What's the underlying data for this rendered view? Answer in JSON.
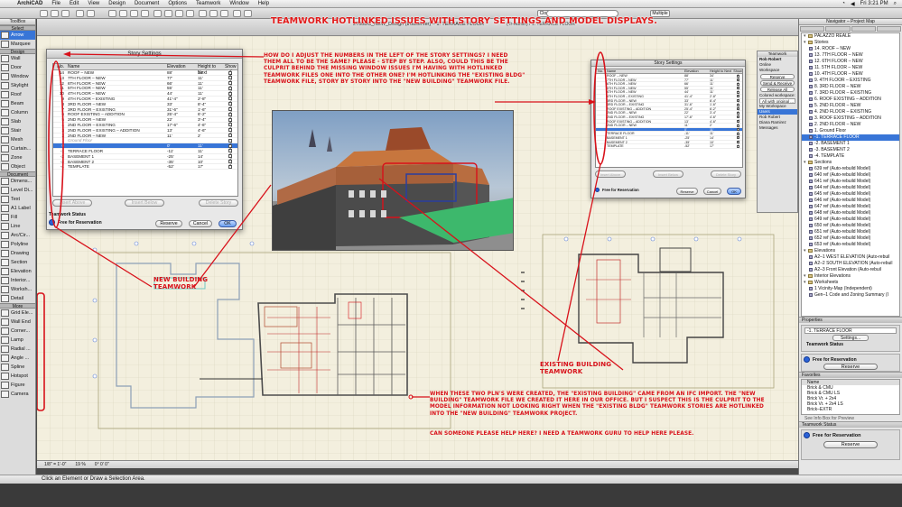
{
  "menubar": {
    "app": "ArchiCAD",
    "items": [
      "File",
      "Edit",
      "View",
      "Design",
      "Document",
      "Options",
      "Teamwork",
      "Window",
      "Help"
    ],
    "clock": "Fri 3:21 PM"
  },
  "toolbar": {
    "close_label": "Close",
    "search_placeholder": "",
    "zoom_label": "Multiple"
  },
  "toolbox": {
    "title": "ToolBox",
    "select_group": "Select",
    "tools_select": [
      {
        "label": "Arrow",
        "selected": true
      },
      {
        "label": "Marquee",
        "selected": false
      }
    ],
    "design_group": "Design",
    "tools_design": [
      "Wall",
      "Door",
      "Window",
      "Skylight",
      "Roof",
      "Beam",
      "Column",
      "Slab",
      "Stair",
      "Mesh",
      "Curtain...",
      "Zone",
      "Object"
    ],
    "document_group": "Document",
    "tools_document": [
      "Dimens...",
      "Level Di...",
      "Text",
      "A1 Label",
      "Fill",
      "Line",
      "Arc/Cir...",
      "Polyline",
      "Drawing",
      "Section",
      "Elevation",
      "Interior...",
      "Worksh...",
      "Detail"
    ],
    "more_group": "More",
    "tools_more": [
      "Grid Ele...",
      "Wall End",
      "Corner...",
      "Lamp",
      "Radial ...",
      "Angle ...",
      "Spline",
      "Hotspot",
      "Figure",
      "Camera"
    ]
  },
  "document": {
    "window_title": "2700DC_NEW_Design (trouserver) – 1. TERRACE FLOOR",
    "window_title_right": "(Tr-Admin) / 1. TERRACE FLOOR",
    "status_items": [
      "1/8\" = 1'-0\"",
      "19 %",
      "0° 0' 0\""
    ]
  },
  "headline": "Teamwork hotlinked issues with story settings and model displays.",
  "question": "How do I adjust the numbers in the left of the story settings? I need them all to be the same? Please - step by step. Also, could this be the culprit behind the missing window issues I'm having with hotlinked teamwork files one into the other one? I'm hotlinking the \"existing bldg\" teamwork file, story by story into the \"new building\" teamwork file.",
  "annotations": {
    "new_building": "New Building\nTeamwork",
    "existing_building": "Existing Building\nTeamwork",
    "created": "When these two PLN's were created, the \"existing building\" came from an IFC import. The \"new building\" teamwork file we created it here in our office. But I suspect this is the culprit to the model information not looking right when the \"existing bldg\" teamwork stories are hotlinked into the \"new building\" teamwork project.",
    "help": "Can someone please help here? I need a teamwork guru to help here please."
  },
  "story_dialog": {
    "title": "Story Settings",
    "columns": [
      "No.",
      "Name",
      "Elevation",
      "Height to Next",
      "Show"
    ],
    "rows": [
      {
        "no": "14",
        "name": "ROOF – NEW",
        "elev": "88'",
        "height": "34'",
        "show": true
      },
      {
        "no": "13",
        "name": "7TH FLOOR – NEW",
        "elev": "77'",
        "height": "11'",
        "show": true
      },
      {
        "no": "12",
        "name": "6TH FLOOR – NEW",
        "elev": "66'",
        "height": "11'",
        "show": true
      },
      {
        "no": "11",
        "name": "5TH FLOOR – NEW",
        "elev": "55'",
        "height": "11'",
        "show": true
      },
      {
        "no": "10",
        "name": "4TH FLOOR – NEW",
        "elev": "44'",
        "height": "11'",
        "show": true
      },
      {
        "no": "9",
        "name": "4TH FLOOR – EXISTING",
        "elev": "41'-4\"",
        "height": "2'-8\"",
        "show": true
      },
      {
        "no": "8",
        "name": "3RD FLOOR – NEW",
        "elev": "33'",
        "height": "8'-4\"",
        "show": true
      },
      {
        "no": "7",
        "name": "3RD FLOOR – EXISTING",
        "elev": "31'-6\"",
        "height": "1'-6\"",
        "show": true
      },
      {
        "no": "6",
        "name": "ROOF EXISTING – ADDITION",
        "elev": "25'-4\"",
        "height": "6'-2\"",
        "show": true
      },
      {
        "no": "5",
        "name": "2ND FLOOR – NEW",
        "elev": "22'",
        "height": "3'-4\"",
        "show": true
      },
      {
        "no": "4",
        "name": "2ND FLOOR – EXISTING",
        "elev": "17'-6\"",
        "height": "4'-6\"",
        "show": true
      },
      {
        "no": "3",
        "name": "2ND FLOOR – EXISTING – ADDITION",
        "elev": "13'",
        "height": "4'-6\"",
        "show": true
      },
      {
        "no": "2",
        "name": "2ND FLOOR – NEW",
        "elev": "11'",
        "height": "2'",
        "show": true
      },
      {
        "no": "1",
        "name": "Ground Floor",
        "elev": "",
        "height": "",
        "show": false,
        "ghost": true
      },
      {
        "no": "0",
        "name": "",
        "elev": "0'",
        "height": "11'",
        "show": true,
        "selected": true
      },
      {
        "no": "-1",
        "name": "TERRACE FLOOR",
        "elev": "-11'",
        "height": "11'",
        "show": true
      },
      {
        "no": "-2",
        "name": "BASEMENT 1",
        "elev": "-25'",
        "height": "14'",
        "show": true
      },
      {
        "no": "-3",
        "name": "BASEMENT 2",
        "elev": "-35'",
        "height": "10'",
        "show": true
      },
      {
        "no": "-4",
        "name": "TEMPLATE",
        "elev": "-52'",
        "height": "17'",
        "show": true
      }
    ],
    "insert_above": "Insert Above",
    "insert_below": "Insert Below",
    "delete_story": "Delete Story",
    "teamwork_status_label": "Teamwork Status",
    "free_label": "Free for Reservation",
    "reserve": "Reserve",
    "cancel": "Cancel",
    "ok": "OK"
  },
  "story_dialog2": {
    "title": "Story Settings",
    "rows": [
      {
        "no": "",
        "name": "ROOF – NEW",
        "elev": "88'",
        "height": "34'"
      },
      {
        "no": "",
        "name": "7TH FLOOR – NEW",
        "elev": "77'",
        "height": "11'"
      },
      {
        "no": "",
        "name": "6TH FLOOR – NEW",
        "elev": "66'",
        "height": "11'"
      },
      {
        "no": "",
        "name": "5TH FLOOR – NEW",
        "elev": "55'",
        "height": "11'"
      },
      {
        "no": "",
        "name": "4TH FLOOR – NEW",
        "elev": "44'",
        "height": "11'"
      },
      {
        "no": "",
        "name": "4TH FLOOR – EXISTING",
        "elev": "41'-4\"",
        "height": "2'-8\""
      },
      {
        "no": "",
        "name": "3RD FLOOR – NEW",
        "elev": "33'",
        "height": "8'-4\""
      },
      {
        "no": "",
        "name": "3RD FLOOR – EXISTING",
        "elev": "31'-6\"",
        "height": "1'-6\""
      },
      {
        "no": "",
        "name": "ROOF EXISTING – ADDITION",
        "elev": "25'-4\"",
        "height": "6'-2\""
      },
      {
        "no": "",
        "name": "2ND FLOOR – NEW",
        "elev": "22'",
        "height": "3'-4\""
      },
      {
        "no": "",
        "name": "2ND FLOOR – EXISTING",
        "elev": "17'-6\"",
        "height": "4'-6\""
      },
      {
        "no": "",
        "name": "ROOF EXISTING – ADDITION",
        "elev": "13'",
        "height": "4'-6\""
      },
      {
        "no": "",
        "name": "2ND FLOOR – NEW",
        "elev": "11'",
        "height": "2'"
      },
      {
        "no": "",
        "name": "",
        "elev": "0'",
        "height": "11'",
        "selected": true
      },
      {
        "no": "",
        "name": "TERRACE FLOOR",
        "elev": "-11'",
        "height": "11'"
      },
      {
        "no": "",
        "name": "BASEMENT 1",
        "elev": "-25'",
        "height": "14'"
      },
      {
        "no": "",
        "name": "BASEMENT 2",
        "elev": "-35'",
        "height": "10'"
      },
      {
        "no": "",
        "name": "TEMPLATE",
        "elev": "-52'",
        "height": "17'"
      }
    ],
    "insert_above": "Insert Above",
    "insert_below": "Insert Below",
    "delete_story": "Delete Story",
    "free_label": "Free for Reservation",
    "reserve": "Reserve",
    "cancel": "Cancel",
    "ok": "OK"
  },
  "tw_panel": {
    "title": "Teamwork",
    "user": "Rob Robert",
    "rows": [
      "Online",
      "Workspace",
      "Reserve",
      "Release All",
      "Colored workspace:",
      "All with original ...",
      "My Workspace",
      "Users",
      "Rob Robert",
      "Diana Ramirez",
      "Messages"
    ],
    "send_receive": "Send & Receive"
  },
  "navigator": {
    "title": "Navigator – Project Map",
    "tree": [
      {
        "label": "PALAZZO REALE",
        "depth": 0,
        "kind": "root"
      },
      {
        "label": "Stories",
        "depth": 0,
        "kind": "folder"
      },
      {
        "label": "14. ROOF – NEW",
        "depth": 1,
        "kind": "item"
      },
      {
        "label": "13. 7TH FLOOR – NEW",
        "depth": 1,
        "kind": "item"
      },
      {
        "label": "12. 6TH FLOOR – NEW",
        "depth": 1,
        "kind": "item"
      },
      {
        "label": "11. 5TH FLOOR – NEW",
        "depth": 1,
        "kind": "item"
      },
      {
        "label": "10. 4TH FLOOR – NEW",
        "depth": 1,
        "kind": "item"
      },
      {
        "label": "9. 4TH FLOOR – EXISTING",
        "depth": 1,
        "kind": "item"
      },
      {
        "label": "8. 3RD FLOOR – NEW",
        "depth": 1,
        "kind": "item"
      },
      {
        "label": "7. 3RD FLOOR – EXISTING",
        "depth": 1,
        "kind": "item"
      },
      {
        "label": "6. ROOF EXISTING – ADDITION",
        "depth": 1,
        "kind": "item"
      },
      {
        "label": "5. 2ND FLOOR – NEW",
        "depth": 1,
        "kind": "item"
      },
      {
        "label": "4. 2ND FLOOR – EXISTING",
        "depth": 1,
        "kind": "item"
      },
      {
        "label": "3. ROOF EXISTING – ADDITION",
        "depth": 1,
        "kind": "item"
      },
      {
        "label": "2. 2ND FLOOR – NEW",
        "depth": 1,
        "kind": "item"
      },
      {
        "label": "1. Ground Floor",
        "depth": 1,
        "kind": "item"
      },
      {
        "label": "-1. TERRACE FLOOR",
        "depth": 1,
        "kind": "item",
        "selected": true
      },
      {
        "label": "-2. BASEMENT 1",
        "depth": 1,
        "kind": "item"
      },
      {
        "label": "-3. BASEMENT 2",
        "depth": 1,
        "kind": "item"
      },
      {
        "label": "-4. TEMPLATE",
        "depth": 1,
        "kind": "item"
      },
      {
        "label": "Sections",
        "depth": 0,
        "kind": "folder"
      },
      {
        "label": "639 ref (Auto-rebuild Model)",
        "depth": 1,
        "kind": "item"
      },
      {
        "label": "640 ref (Auto-rebuild Model)",
        "depth": 1,
        "kind": "item"
      },
      {
        "label": "641 ref (Auto-rebuild Model)",
        "depth": 1,
        "kind": "item"
      },
      {
        "label": "644 ref (Auto-rebuild Model)",
        "depth": 1,
        "kind": "item"
      },
      {
        "label": "645 ref (Auto-rebuild Model)",
        "depth": 1,
        "kind": "item"
      },
      {
        "label": "646 ref (Auto-rebuild Model)",
        "depth": 1,
        "kind": "item"
      },
      {
        "label": "647 ref (Auto-rebuild Model)",
        "depth": 1,
        "kind": "item"
      },
      {
        "label": "648 ref (Auto-rebuild Model)",
        "depth": 1,
        "kind": "item"
      },
      {
        "label": "649 ref (Auto-rebuild Model)",
        "depth": 1,
        "kind": "item"
      },
      {
        "label": "650 ref (Auto-rebuild Model)",
        "depth": 1,
        "kind": "item"
      },
      {
        "label": "651 ref (Auto-rebuild Model)",
        "depth": 1,
        "kind": "item"
      },
      {
        "label": "652 ref (Auto-rebuild Model)",
        "depth": 1,
        "kind": "item"
      },
      {
        "label": "653 ref (Auto-rebuild Model)",
        "depth": 1,
        "kind": "item"
      },
      {
        "label": "Elevations",
        "depth": 0,
        "kind": "folder"
      },
      {
        "label": "A2–1 WEST ELEVATION (Auto-rebuil",
        "depth": 1,
        "kind": "item"
      },
      {
        "label": "A2–2 SOUTH ELEVATION (Auto-rebuil",
        "depth": 1,
        "kind": "item"
      },
      {
        "label": "A2–3 Front Elevation (Auto-rebuil",
        "depth": 1,
        "kind": "item"
      },
      {
        "label": "Interior Elevations",
        "depth": 0,
        "kind": "folder"
      },
      {
        "label": "Worksheets",
        "depth": 0,
        "kind": "folder"
      },
      {
        "label": "1 Vicinity-Map (Independent)",
        "depth": 1,
        "kind": "item"
      },
      {
        "label": "Gen–1 Code and Zoning Summary (I",
        "depth": 1,
        "kind": "item"
      }
    ],
    "properties_label": "Properties",
    "properties_value": "-1.    TERRACE FLOOR",
    "settings_button": "Settings...",
    "tw_status_label": "Teamwork Status",
    "free_label": "Free for Reservation",
    "reserve_button": "Reserve",
    "favorites_label": "Favorites",
    "favorites": [
      "Name",
      "Brick & CMU",
      "Brick & CMU LS",
      "Brick Vr. + 2x4",
      "Brick Vr. + 2x4 LS",
      "Brick–EXTR"
    ],
    "favorites_hint": "See Info Box for Preview",
    "tw_status_label2": "Teamwork Status",
    "free_label2": "Free for Reservation",
    "reserve_button2": "Reserve"
  },
  "statusbar": {
    "text": "Click an Element or Draw a Selection Area."
  },
  "colors": {
    "annotation_red": "#d8111a",
    "selection_blue": "#3875d7",
    "plan_bg": "#f3efde"
  }
}
